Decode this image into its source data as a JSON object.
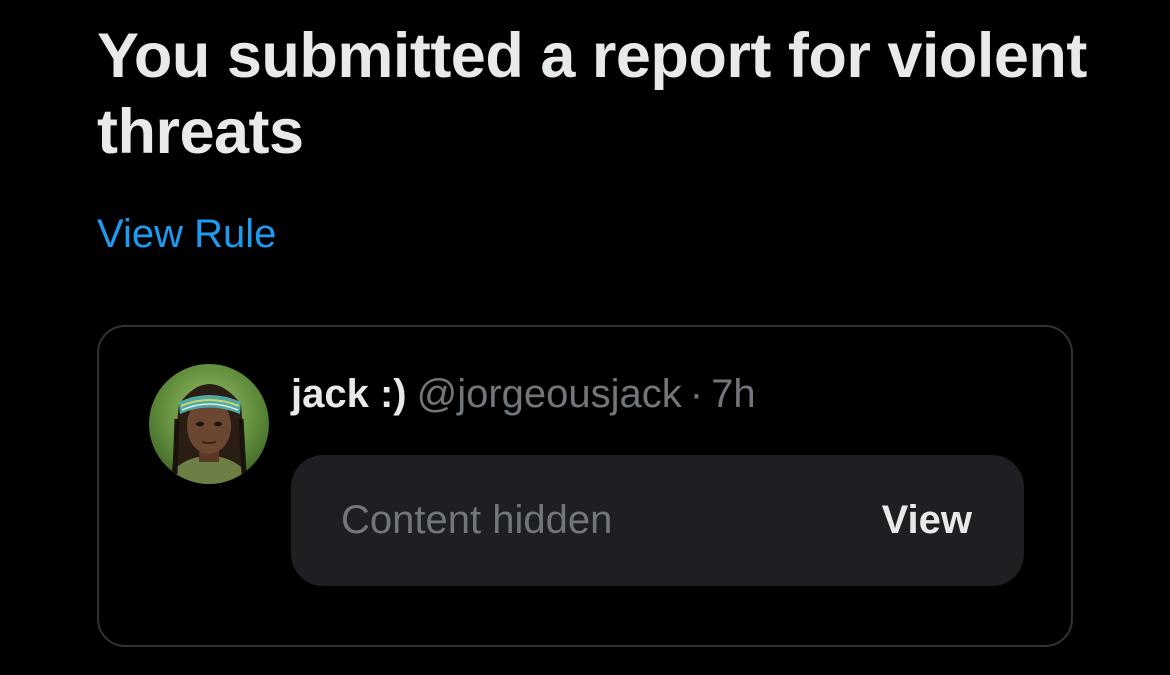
{
  "report": {
    "heading": "You submitted a report for violent threats",
    "view_rule_label": "View Rule"
  },
  "post": {
    "display_name": "jack :)",
    "handle": "@jorgeousjack",
    "separator": "·",
    "timestamp": "7h",
    "avatar_icon": "user-avatar-photo",
    "content_hidden_label": "Content hidden",
    "view_label": "View"
  },
  "colors": {
    "background": "#000000",
    "primary_text": "#e7e9ea",
    "secondary_text": "#71767b",
    "link": "#1d9bf0",
    "card_border": "#2f3336",
    "hidden_box_bg": "#1d1f23"
  }
}
